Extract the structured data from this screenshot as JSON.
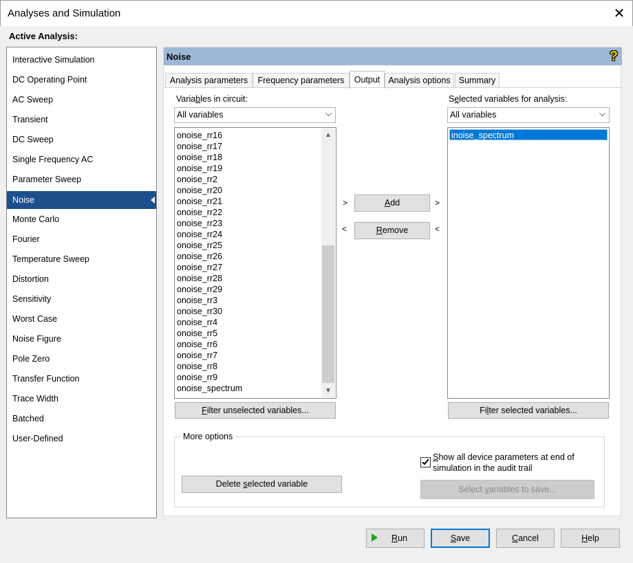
{
  "window": {
    "title": "Analyses and Simulation",
    "close_glyph": "✕"
  },
  "active_analysis_label": "Active Analysis:",
  "analyses": [
    "Interactive Simulation",
    "DC Operating Point",
    "AC Sweep",
    "Transient",
    "DC Sweep",
    "Single Frequency AC",
    "Parameter Sweep",
    "Noise",
    "Monte Carlo",
    "Fourier",
    "Temperature Sweep",
    "Distortion",
    "Sensitivity",
    "Worst Case",
    "Noise Figure",
    "Pole Zero",
    "Transfer Function",
    "Trace Width",
    "Batched",
    "User-Defined"
  ],
  "selected_analysis_index": 7,
  "panel": {
    "title": "Noise",
    "help_icon": "help-question-icon",
    "help_glyph": "?"
  },
  "tabs": [
    "Analysis parameters",
    "Frequency parameters",
    "Output",
    "Analysis options",
    "Summary"
  ],
  "active_tab_index": 2,
  "left": {
    "label_pre": "Varia",
    "label_ul": "b",
    "label_post": "les in circuit:",
    "filter_value": "All variables",
    "variables": [
      "onoise_rr16",
      "onoise_rr17",
      "onoise_rr18",
      "onoise_rr19",
      "onoise_rr2",
      "onoise_rr20",
      "onoise_rr21",
      "onoise_rr22",
      "onoise_rr23",
      "onoise_rr24",
      "onoise_rr25",
      "onoise_rr26",
      "onoise_rr27",
      "onoise_rr28",
      "onoise_rr29",
      "onoise_rr3",
      "onoise_rr30",
      "onoise_rr4",
      "onoise_rr5",
      "onoise_rr6",
      "onoise_rr7",
      "onoise_rr8",
      "onoise_rr9",
      "onoise_spectrum"
    ],
    "filter_button_ul": "F",
    "filter_button_rest": "ilter unselected variables..."
  },
  "right": {
    "label_pre": "S",
    "label_ul": "e",
    "label_post": "lected variables for analysis:",
    "filter_value": "All variables",
    "variables": [
      "inoise_spectrum"
    ],
    "filter_button_pre": "Fi",
    "filter_button_ul": "l",
    "filter_button_post": "ter selected variables..."
  },
  "transfer": {
    "add_ul": "A",
    "add_rest": "dd",
    "remove_ul": "R",
    "remove_rest": "emove",
    "gt": ">",
    "lt": "<"
  },
  "more_options": {
    "title": "More options",
    "delete_pre": "Delete ",
    "delete_ul": "s",
    "delete_post": "elected variable",
    "checkbox_checked": true,
    "checkbox_ul": "S",
    "checkbox_line1_rest": "how all device parameters at end of",
    "checkbox_line2": "simulation in the audit trail",
    "select_pre": "Select ",
    "select_ul": "v",
    "select_post": "ariables to save..."
  },
  "footer": {
    "run_ul": "R",
    "run_rest": "un",
    "save_ul": "S",
    "save_rest": "ave",
    "cancel_ul": "C",
    "cancel_rest": "ancel",
    "help_ul": "H",
    "help_rest": "elp"
  }
}
